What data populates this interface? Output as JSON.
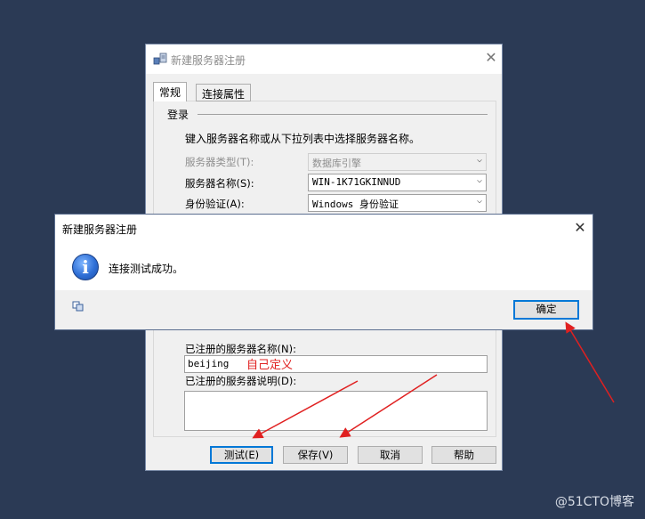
{
  "main_dialog": {
    "title": "新建服务器注册",
    "tabs": [
      "常规",
      "连接属性"
    ],
    "login_group": "登录",
    "instruction": "键入服务器名称或从下拉列表中选择服务器名称。",
    "server_type_label": "服务器类型(T):",
    "server_type_value": "数据库引擎",
    "server_name_label": "服务器名称(S):",
    "server_name_value": "WIN-1K71GKINNUD",
    "auth_label": "身份验证(A):",
    "auth_value": "Windows 身份验证",
    "registered_name_label": "已注册的服务器名称(N):",
    "registered_name_value": "beijing",
    "registered_desc_label": "已注册的服务器说明(D):",
    "buttons": {
      "test": "测试(E)",
      "save": "保存(V)",
      "cancel": "取消",
      "help": "帮助"
    }
  },
  "annotation": "自己定义",
  "message_box": {
    "title": "新建服务器注册",
    "text": "连接测试成功。",
    "ok": "确定"
  },
  "watermark": "@51CTO博客",
  "colors": {
    "background": "#2b3a55",
    "annotation": "#e02020",
    "focus": "#0078d7"
  }
}
